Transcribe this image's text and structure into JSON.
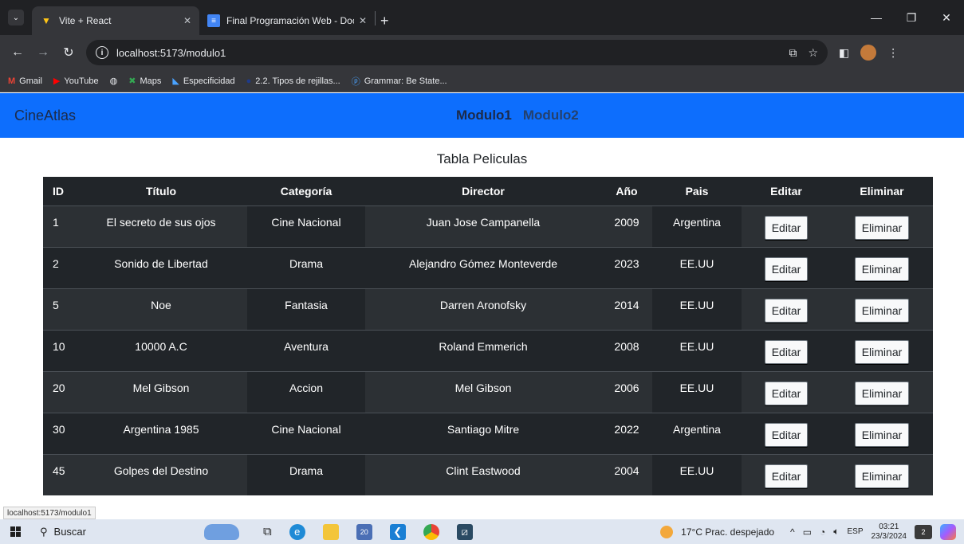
{
  "browser": {
    "tabs": [
      {
        "title": "Vite + React",
        "icon": "vite-icon",
        "active": true
      },
      {
        "title": "Final Programación Web - Docu",
        "icon": "docs-icon",
        "active": false
      }
    ],
    "url": "localhost:5173/modulo1",
    "bookmarks": [
      {
        "label": "Gmail",
        "icon": "gmail-icon"
      },
      {
        "label": "YouTube",
        "icon": "youtube-icon"
      },
      {
        "label": "",
        "icon": "globe-icon"
      },
      {
        "label": "Maps",
        "icon": "maps-icon"
      },
      {
        "label": "Especificidad",
        "icon": "bookmark-icon"
      },
      {
        "label": "2.2. Tipos de rejillas...",
        "icon": "bookmark-icon"
      },
      {
        "label": "Grammar: Be State...",
        "icon": "pinterest-icon"
      }
    ],
    "status_url": "localhost:5173/modulo1"
  },
  "app": {
    "brand": "CineAtlas",
    "nav": [
      "Modulo1",
      "Modulo2"
    ],
    "table_title": "Tabla Peliculas",
    "columns": [
      "ID",
      "Título",
      "Categoría",
      "Director",
      "Año",
      "Pais",
      "Editar",
      "Eliminar"
    ],
    "edit_label": "Editar",
    "delete_label": "Eliminar",
    "rows": [
      {
        "id": "1",
        "titulo": "El secreto de sus ojos",
        "categoria": "Cine Nacional",
        "director": "Juan Jose Campanella",
        "anio": "2009",
        "pais": "Argentina"
      },
      {
        "id": "2",
        "titulo": "Sonido de Libertad",
        "categoria": "Drama",
        "director": "Alejandro Gómez Monteverde",
        "anio": "2023",
        "pais": "EE.UU"
      },
      {
        "id": "5",
        "titulo": "Noe",
        "categoria": "Fantasia",
        "director": "Darren Aronofsky",
        "anio": "2014",
        "pais": "EE.UU"
      },
      {
        "id": "10",
        "titulo": "10000 A.C",
        "categoria": "Aventura",
        "director": "Roland Emmerich",
        "anio": "2008",
        "pais": "EE.UU"
      },
      {
        "id": "20",
        "titulo": "Mel Gibson",
        "categoria": "Accion",
        "director": "Mel Gibson",
        "anio": "2006",
        "pais": "EE.UU"
      },
      {
        "id": "30",
        "titulo": "Argentina 1985",
        "categoria": "Cine Nacional",
        "director": "Santiago Mitre",
        "anio": "2022",
        "pais": "Argentina"
      },
      {
        "id": "45",
        "titulo": "Golpes del Destino",
        "categoria": "Drama",
        "director": "Clint Eastwood",
        "anio": "2004",
        "pais": "EE.UU"
      }
    ]
  },
  "taskbar": {
    "search_placeholder": "Buscar",
    "weather": "17°C  Prac. despejado",
    "language": "ESP",
    "time": "03:21",
    "date": "23/3/2024",
    "teams_badge": "20",
    "notif_badge": "2"
  },
  "colors": {
    "navbar": "#0d6efd",
    "table_dark": "#212529",
    "table_striped": "#2c3034"
  }
}
